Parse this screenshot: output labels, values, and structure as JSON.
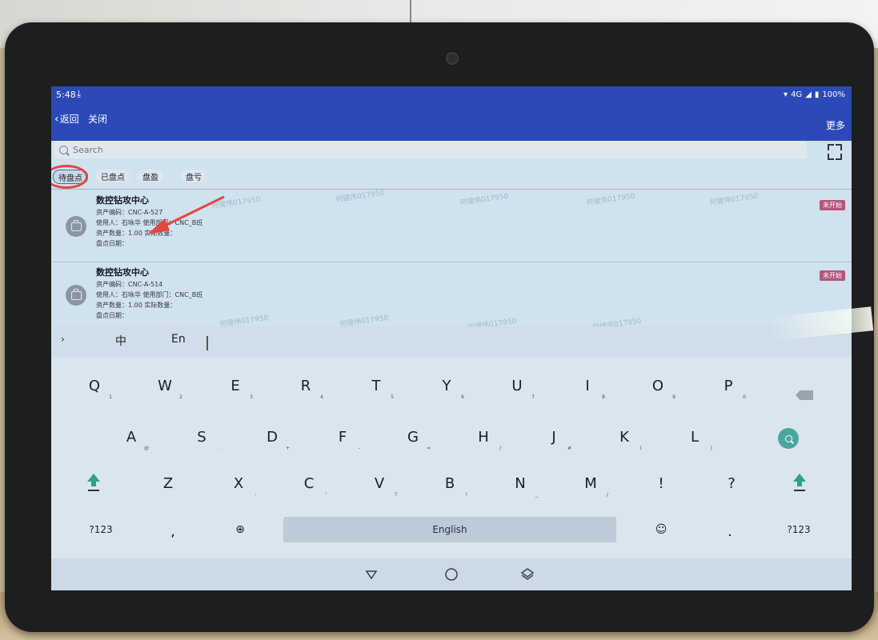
{
  "status": {
    "time": "5:48",
    "network": "4G",
    "battery": "100%"
  },
  "appbar": {
    "back_label": "返回",
    "close_label": "关闭",
    "more_label": "更多"
  },
  "search": {
    "placeholder": "Search"
  },
  "tabs": [
    {
      "label": "待盘点"
    },
    {
      "label": "已盘点"
    },
    {
      "label": "盘盈"
    },
    {
      "label": "盘亏"
    }
  ],
  "watermark": "何健伟017950",
  "items": [
    {
      "title": "数控钻攻中心",
      "code": "资产编码：CNC-A-527",
      "user": "使用人：石咏华  使用部门：CNC_B班",
      "qty": "资产数量：1.00  实际数量：",
      "date": "盘点日期：",
      "badge": "未开始"
    },
    {
      "title": "数控钻攻中心",
      "code": "资产编码：CNC-A-514",
      "user": "使用人：石咏华  使用部门：CNC_B班",
      "qty": "资产数量：1.00  实际数量：",
      "date": "盘点日期：",
      "badge": "未开始"
    }
  ],
  "keyboard": {
    "toolbar": {
      "chinese": "中",
      "english": "En"
    },
    "row1": [
      {
        "k": "Q",
        "h": "1"
      },
      {
        "k": "W",
        "h": "2"
      },
      {
        "k": "E",
        "h": "3"
      },
      {
        "k": "R",
        "h": "4"
      },
      {
        "k": "T",
        "h": "5"
      },
      {
        "k": "Y",
        "h": "6"
      },
      {
        "k": "U",
        "h": "7"
      },
      {
        "k": "I",
        "h": "8"
      },
      {
        "k": "O",
        "h": "9"
      },
      {
        "k": "P",
        "h": "0"
      }
    ],
    "row2": [
      {
        "k": "A",
        "h": "@"
      },
      {
        "k": "S",
        "h": "."
      },
      {
        "k": "D",
        "h": "+"
      },
      {
        "k": "F",
        "h": "-"
      },
      {
        "k": "G",
        "h": "="
      },
      {
        "k": "H",
        "h": "/"
      },
      {
        "k": "J",
        "h": "#"
      },
      {
        "k": "K",
        "h": "("
      },
      {
        "k": "L",
        "h": ")"
      }
    ],
    "row3": [
      {
        "k": "Z",
        "h": ""
      },
      {
        "k": "X",
        "h": ":"
      },
      {
        "k": "C",
        "h": "'"
      },
      {
        "k": "V",
        "h": "?"
      },
      {
        "k": "B",
        "h": "!"
      },
      {
        "k": "N",
        "h": "_"
      },
      {
        "k": "M",
        "h": "/"
      },
      {
        "k": "!",
        "h": ""
      },
      {
        "k": "?",
        "h": ""
      }
    ],
    "row4": {
      "symbols": "?123",
      "comma": ",",
      "space": "English",
      "period": ".",
      "symbols_right": "?123"
    }
  },
  "colors": {
    "appbar": "#2c49b8",
    "badge": "#b3567a",
    "search_key": "#4aa7a0",
    "annotation": "#e44640"
  }
}
